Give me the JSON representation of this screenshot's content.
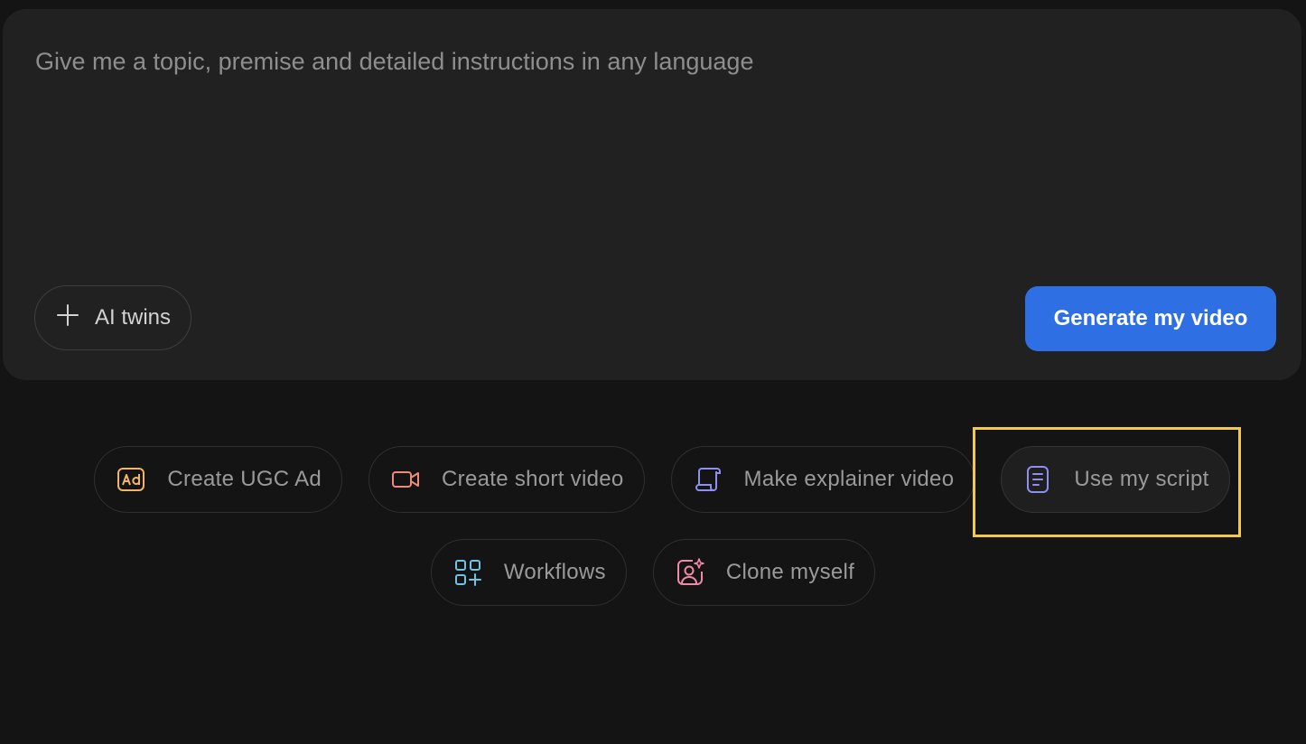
{
  "prompt": {
    "placeholder": "Give me a topic, premise and detailed instructions in any language",
    "value": ""
  },
  "ai_twins": {
    "label": "AI twins",
    "icon": "plus-icon"
  },
  "generate": {
    "label": "Generate my video",
    "color": "#2f6fe4"
  },
  "chips_row1": [
    {
      "label": "Create UGC Ad",
      "icon": "ad-icon",
      "color": "#f0b46a"
    },
    {
      "label": "Create short video",
      "icon": "video-camera-icon",
      "color": "#f08a7a"
    },
    {
      "label": "Make explainer video",
      "icon": "scroll-icon",
      "color": "#8f8ff0"
    },
    {
      "label": "Use my script",
      "icon": "document-icon",
      "color": "#8f8ff0"
    }
  ],
  "chips_row2": [
    {
      "label": "Workflows",
      "icon": "grid-plus-icon",
      "color": "#6ec3e6"
    },
    {
      "label": "Clone myself",
      "icon": "user-sparkle-icon",
      "color": "#f08aa8"
    }
  ],
  "highlight": {
    "color": "#f2c94c"
  }
}
